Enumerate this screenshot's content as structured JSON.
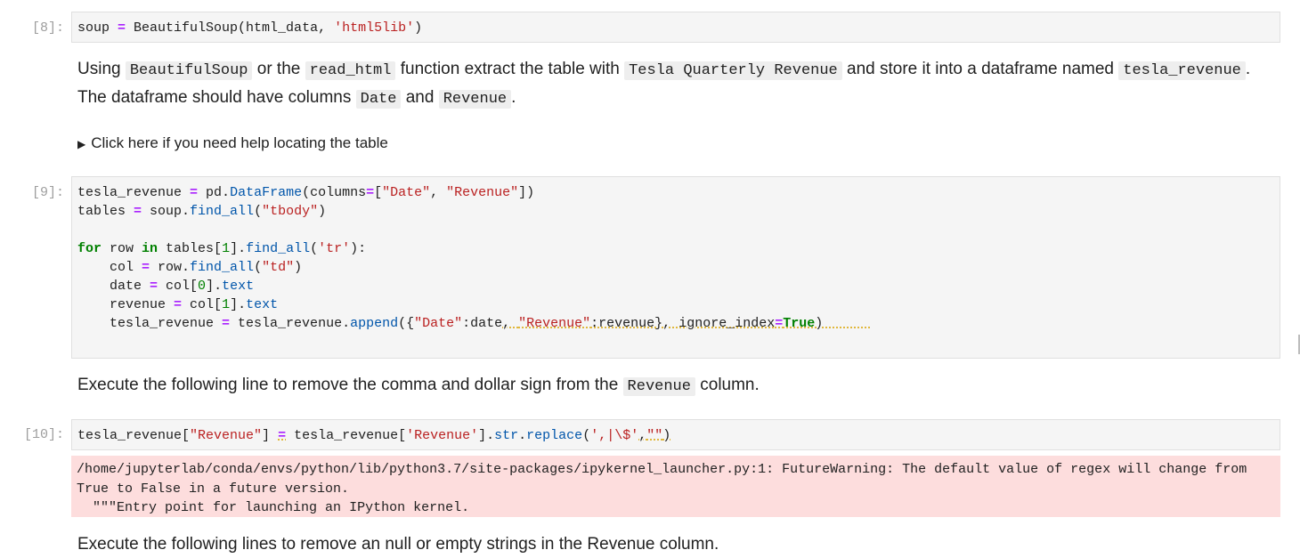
{
  "cells": {
    "c8": {
      "prompt": "[8]:"
    },
    "md1": {
      "text_using": "Using ",
      "code_bs": "BeautifulSoup",
      "text_or": " or the ",
      "code_readhtml": "read_html",
      "text_func": " function extract the table with ",
      "code_tqr": "Tesla Quarterly Revenue",
      "text_store": " and store it into a dataframe named ",
      "code_tr": "tesla_revenue",
      "text_df": ". The dataframe should have columns ",
      "code_date": "Date",
      "text_and": " and ",
      "code_revenue": "Revenue",
      "text_end": "."
    },
    "details": {
      "summary": "Click here if you need help locating the table"
    },
    "c9": {
      "prompt": "[9]:"
    },
    "md2": {
      "text_a": "Execute the following line to remove the comma and dollar sign from the ",
      "code_revenue": "Revenue",
      "text_b": " column."
    },
    "c10": {
      "prompt": "[10]:"
    },
    "stderr": {
      "line1": "/home/jupyterlab/conda/envs/python/lib/python3.7/site-packages/ipykernel_launcher.py:1: FutureWarning: The default value of regex will change from True to False in a future version.",
      "line2": "  \"\"\"Entry point for launching an IPython kernel."
    },
    "md3": {
      "text": "Execute the following lines to remove an null or empty strings in the Revenue column."
    }
  }
}
